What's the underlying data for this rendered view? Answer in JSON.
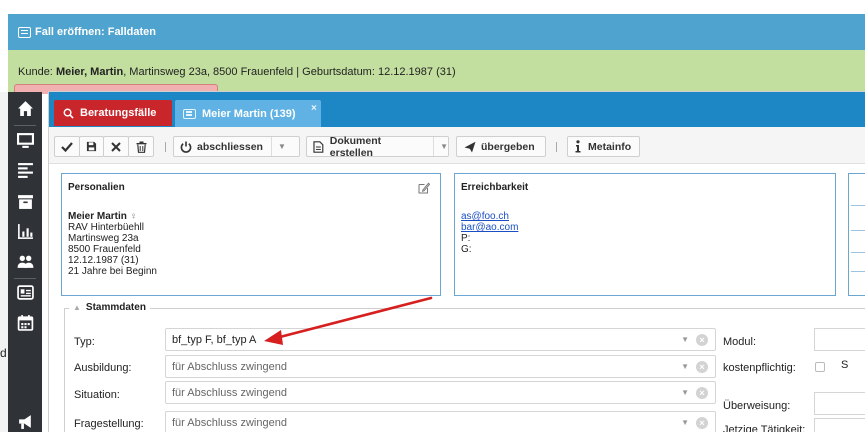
{
  "background": {
    "title": "Fall eröffnen: Falldaten",
    "kunde_label": "Kunde:",
    "kunde_name": "Meier, Martin",
    "kunde_rest": ", Martinsweg 23a, 8500 Frauenfeld | Geburtsdatum: 12.12.1987 (31)",
    "side_letter": "d"
  },
  "sidebar": {
    "icons": [
      "home-icon",
      "desktop-icon",
      "list-icon",
      "archive-icon",
      "bar-chart-icon",
      "users-icon",
      "id-card-icon",
      "calendar-icon",
      "megaphone-icon"
    ]
  },
  "tabs": {
    "beratung": "Beratungsfälle",
    "active": "Meier Martin (139)",
    "close": "×"
  },
  "toolbar": {
    "abschliessen": "abschliessen",
    "dokument": "Dokument erstellen",
    "uebergeben": "übergeben",
    "metainfo": "Metainfo",
    "separator": "|"
  },
  "personalien": {
    "title": "Personalien",
    "name": "Meier Martin",
    "gender_symbol": "♀",
    "line1": "RAV Hinterbüehll",
    "line2": "Martinsweg 23a",
    "line3": "8500 Frauenfeld",
    "line4": "12.12.1987 (31)",
    "line5": "21 Jahre bei Beginn"
  },
  "erreichbarkeit": {
    "title": "Erreichbarkeit",
    "email1": "as@foo.ch",
    "email2": "bar@ao.com",
    "p_label": "P:",
    "g_label": "G:"
  },
  "stammdaten": {
    "legend": "Stammdaten",
    "typ_label": "Typ:",
    "typ_value": "bf_typ F, bf_typ A",
    "ausbildung_label": "Ausbildung:",
    "ausbildung_placeholder": "für Abschluss zwingend",
    "situation_label": "Situation:",
    "situation_placeholder": "für Abschluss zwingend",
    "fragestellung_label": "Fragestellung:",
    "fragestellung_placeholder": "für Abschluss zwingend",
    "modul_label": "Modul:",
    "kostenpflichtig_label": "kostenpflichtig:",
    "s_label": "S",
    "ueberweisung_label": "Überweisung:",
    "taetigkeit_label": "Jetzige Tätigkeit:"
  },
  "colors": {
    "titlebar": "#4ea3cf",
    "kunde_bar": "#c3df9f",
    "tabbar": "#1d86c4",
    "tab_red": "#c8262b",
    "tab_active": "#5fb2e3",
    "sidebar": "#2f3337",
    "annotation_arrow": "#d62020"
  }
}
